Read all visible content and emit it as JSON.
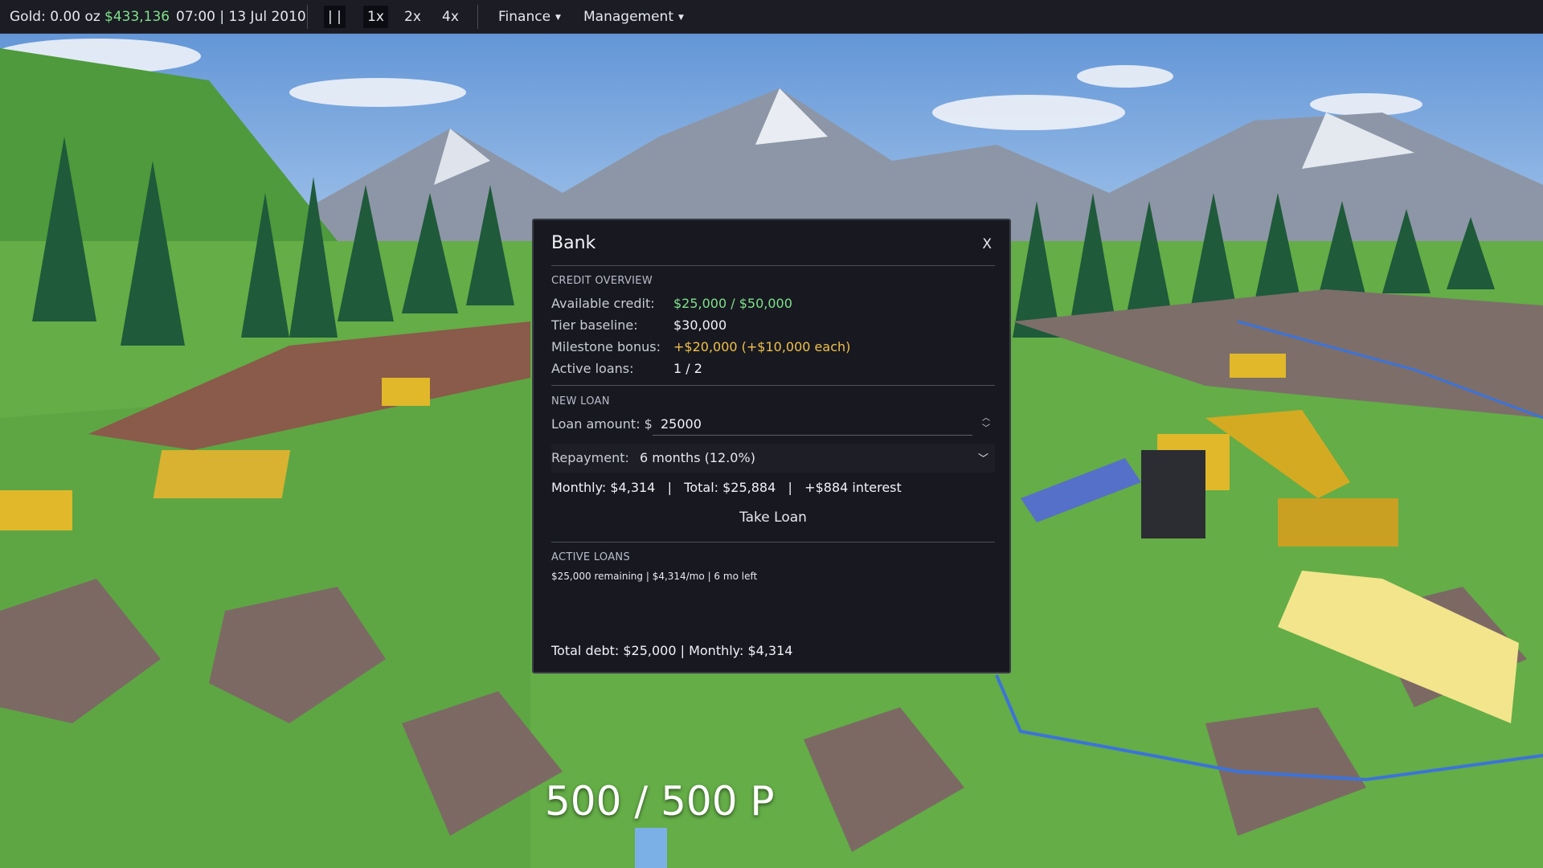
{
  "topbar": {
    "gold": "Gold: 0.00 oz",
    "money": "$433,136",
    "datetime": "07:00 | 13 Jul 2010",
    "pause_label": "| |",
    "speeds": [
      "1x",
      "2x",
      "4x"
    ],
    "active_speed": "1x",
    "menus": [
      "Finance",
      "Management"
    ]
  },
  "bank": {
    "title": "Bank",
    "close_label": "X",
    "credit_section": "CREDIT OVERVIEW",
    "available_label": "Available credit:",
    "available_value": "$25,000  /  $50,000",
    "tier_label": "Tier baseline:",
    "tier_value": "$30,000",
    "milestone_label": "Milestone bonus:",
    "milestone_value": "+$20,000  (+$10,000 each)",
    "active_label": "Active loans:",
    "active_value": "1 / 2",
    "new_loan_section": "NEW LOAN",
    "loan_amount_label": "Loan amount: $",
    "loan_amount_value": "25000",
    "repayment_label": "Repayment:",
    "repayment_value": "6 months (12.0%)",
    "summary": "Monthly: $4,314   |   Total: $25,884   |   +$884 interest",
    "take_loan_label": "Take Loan",
    "active_loans_section": "ACTIVE LOANS",
    "active_loans": [
      "$25,000 remaining | $4,314/mo | 6 mo left"
    ],
    "total_debt": "Total debt: $25,000 | Monthly: $4,314"
  },
  "hud": {
    "power": "500 / 500 P"
  },
  "colors": {
    "panel_bg": "#181920",
    "green_text": "#7fe08a",
    "gold_text": "#f0c04a",
    "topbar_bg": "#1b1c24"
  }
}
